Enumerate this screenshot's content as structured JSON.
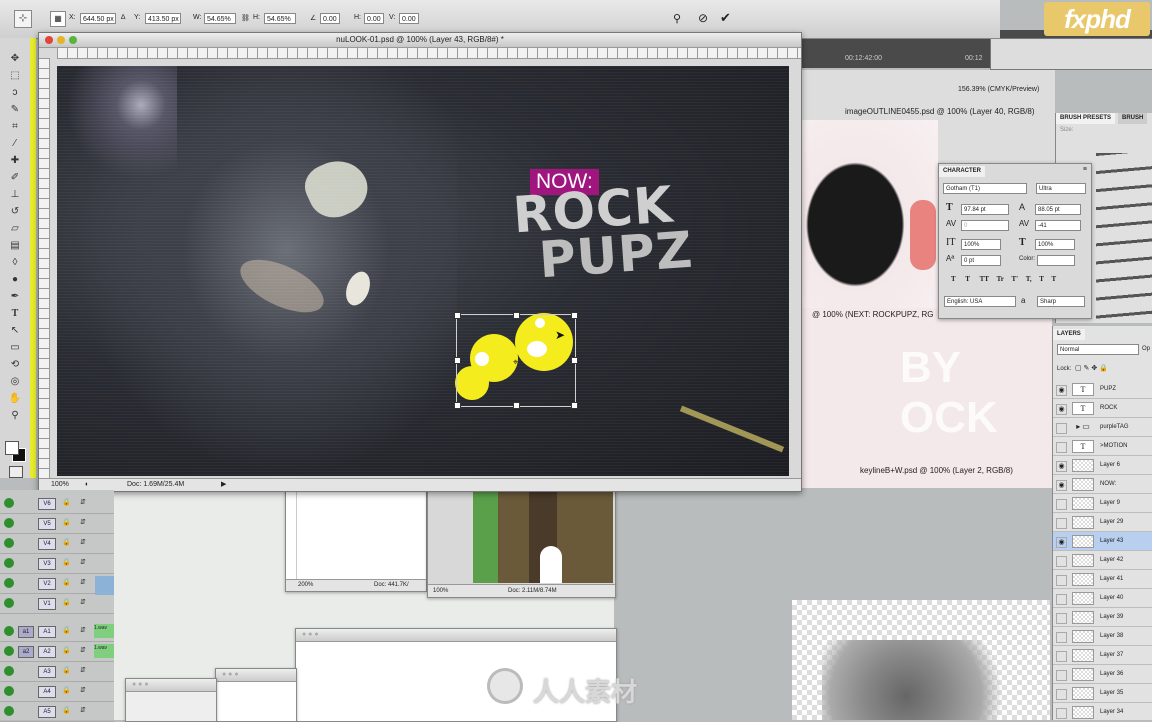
{
  "options_bar": {
    "x_label": "X:",
    "x_value": "644.50 px",
    "y_label": "Y:",
    "y_value": "413.50 px",
    "w_label": "W:",
    "w_value": "54.65%",
    "h_label": "H:",
    "h_value": "54.65%",
    "angle_value": "0.00",
    "hskew_label": "H:",
    "hskew_value": "0.00",
    "vskew_label": "V:",
    "vskew_value": "0.00"
  },
  "watermark": {
    "brand": "fxphd",
    "site": "人人素材"
  },
  "main_window": {
    "title": "nuLOOK-01.psd @ 100% (Layer 43, RGB/8#) *",
    "zoom": "100%",
    "doc_size": "Doc: 1.69M/25.4M",
    "artwork": {
      "tag": "NOW:",
      "line1": "ROCK",
      "line2": "PUPZ"
    }
  },
  "background_windows": {
    "timecode1": "00:12:42:00",
    "timecode2": "00:12",
    "image_outline_title": "imageOUTLINE0455.psd @ 100% (Layer 40, RGB/8)",
    "zoom_cmyk": "156.39% (CMYK/Preview)",
    "next_title": "@ 100% (NEXT: ROCKPUPZ, RG",
    "keyline_title": "keylineB+W.psd @ 100% (Layer 2, RGB/8)",
    "win2_zoom": "200%",
    "win2_doc": "Doc: 441.7K/",
    "win3_zoom": "100%",
    "win3_doc": "Doc: 2.11M/8.74M"
  },
  "brush_panel": {
    "tab1": "BRUSH PRESETS",
    "tab2": "BRUSH",
    "size_label": "Size:"
  },
  "character_panel": {
    "title": "CHARACTER",
    "font_family": "Gotham (T1)",
    "font_style": "Ultra",
    "font_size": "97.84 pt",
    "leading": "88.05 pt",
    "kerning": "0",
    "tracking": "-41",
    "vscale": "100%",
    "hscale": "100%",
    "baseline": "0 pt",
    "color_label": "Color:",
    "language": "English: USA",
    "aa_label": "a",
    "antialias": "Sharp",
    "style_buttons": [
      "T",
      "T",
      "TT",
      "Tr",
      "T'",
      "T,",
      "T",
      "T"
    ]
  },
  "layers_panel": {
    "title": "LAYERS",
    "blend_mode": "Normal",
    "opacity_label": "Op",
    "lock_label": "Lock:",
    "layers": [
      {
        "name": "PUPZ",
        "type": "text",
        "visible": true,
        "selected": false
      },
      {
        "name": "ROCK",
        "type": "text",
        "visible": true,
        "selected": false
      },
      {
        "name": "purpleTAG",
        "type": "group",
        "visible": false,
        "selected": false
      },
      {
        "name": ">MOTION",
        "type": "text",
        "visible": false,
        "selected": false
      },
      {
        "name": "Layer 6",
        "type": "pixel",
        "visible": true,
        "selected": false
      },
      {
        "name": "NOW:",
        "type": "pixel",
        "visible": true,
        "selected": false
      },
      {
        "name": "Layer 9",
        "type": "pixel",
        "visible": false,
        "selected": false
      },
      {
        "name": "Layer 29",
        "type": "pixel",
        "visible": false,
        "selected": false
      },
      {
        "name": "Layer 43",
        "type": "pixel",
        "visible": true,
        "selected": true
      },
      {
        "name": "Layer 42",
        "type": "pixel",
        "visible": false,
        "selected": false
      },
      {
        "name": "Layer 41",
        "type": "pixel",
        "visible": false,
        "selected": false
      },
      {
        "name": "Layer 40",
        "type": "pixel",
        "visible": false,
        "selected": false
      },
      {
        "name": "Layer 39",
        "type": "pixel",
        "visible": false,
        "selected": false
      },
      {
        "name": "Layer 38",
        "type": "pixel",
        "visible": false,
        "selected": false
      },
      {
        "name": "Layer 37",
        "type": "pixel",
        "visible": false,
        "selected": false
      },
      {
        "name": "Layer 36",
        "type": "pixel",
        "visible": false,
        "selected": false
      },
      {
        "name": "Layer 35",
        "type": "pixel",
        "visible": false,
        "selected": false
      },
      {
        "name": "Layer 34",
        "type": "pixel",
        "visible": false,
        "selected": false
      }
    ]
  },
  "timeline": {
    "video_tracks": [
      "V6",
      "V5",
      "V4",
      "V3",
      "V2",
      "V1"
    ],
    "audio_tracks": [
      {
        "src": "a1",
        "dst": "A1",
        "clip": "1.wav"
      },
      {
        "src": "a2",
        "dst": "A2",
        "clip": "1.wav"
      },
      {
        "src": "",
        "dst": "A3",
        "clip": ""
      },
      {
        "src": "",
        "dst": "A4",
        "clip": ""
      },
      {
        "src": "",
        "dst": "A5",
        "clip": ""
      }
    ]
  },
  "colors": {
    "tag_magenta": "#a0157e",
    "highlight_yellow": "#f4ec1c",
    "selected_layer": "#b8cff0"
  }
}
